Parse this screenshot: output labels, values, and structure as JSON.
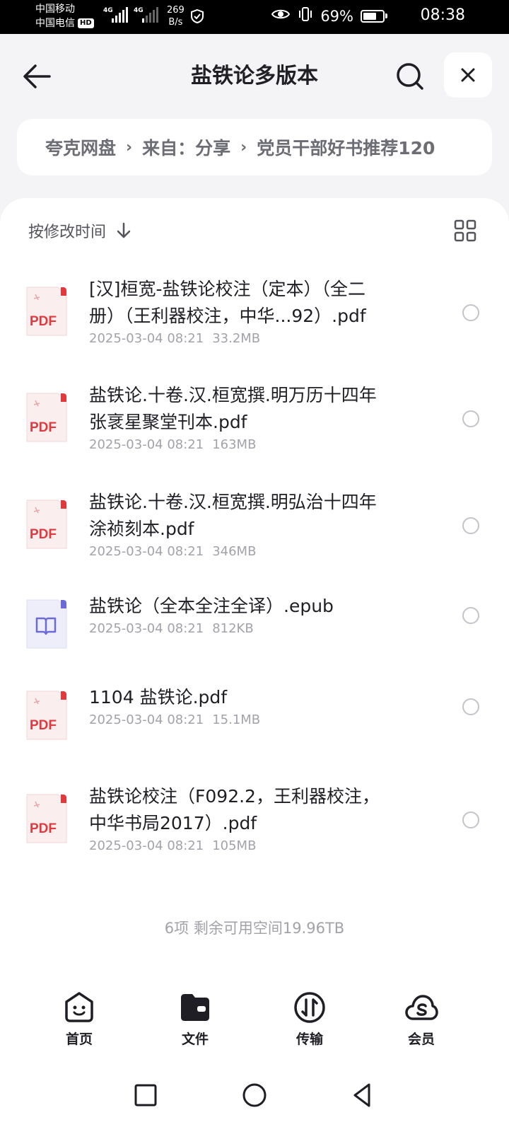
{
  "status_bar": {
    "carrier1": "中国移动",
    "carrier2": "中国电信",
    "hd": "HD",
    "net1": "4G",
    "net2": "4G",
    "speed_value": "269",
    "speed_unit": "B/s",
    "battery": "69%",
    "battery_level": 0.69,
    "time": "08:38"
  },
  "header": {
    "title": "盐铁论多版本",
    "back_icon": "back-arrow-icon",
    "search_icon": "search-icon",
    "close_icon": "close-icon"
  },
  "breadcrumb": {
    "items": [
      "夸克网盘",
      "来自：分享",
      "党员干部好书推荐120"
    ]
  },
  "sort": {
    "label": "按修改时间",
    "direction_icon": "arrow-down-icon",
    "view_icon": "grid-view-icon"
  },
  "files": [
    {
      "type": "pdf",
      "icon_label": "PDF",
      "name_line1": "[汉]桓宽-盐铁论校注（定本）（全二",
      "name_line2": "册）（王利器校注，中华...92）.pdf",
      "date": "2025-03-04 08:21",
      "size": "33.2MB"
    },
    {
      "type": "pdf",
      "icon_label": "PDF",
      "name_line1": "盐铁论.十卷.汉.桓宽撰.明万历十四年",
      "name_line2": "张衺星聚堂刊本.pdf",
      "date": "2025-03-04 08:21",
      "size": "163MB"
    },
    {
      "type": "pdf",
      "icon_label": "PDF",
      "name_line1": "盐铁论.十卷.汉.桓宽撰.明弘治十四年",
      "name_line2": "涂祯刻本.pdf",
      "date": "2025-03-04 08:21",
      "size": "346MB"
    },
    {
      "type": "epub",
      "icon_label": "",
      "name_line1": "盐铁论（全本全注全译）.epub",
      "name_line2": "",
      "date": "2025-03-04 08:21",
      "size": "812KB"
    },
    {
      "type": "pdf",
      "icon_label": "PDF",
      "name_line1": "1104 盐铁论.pdf",
      "name_line2": "",
      "date": "2025-03-04 08:21",
      "size": "15.1MB"
    },
    {
      "type": "pdf",
      "icon_label": "PDF",
      "name_line1": "盐铁论校注（F092.2，王利器校注，",
      "name_line2": "中华书局2017）.pdf",
      "date": "2025-03-04 08:21",
      "size": "105MB"
    }
  ],
  "summary": "6项 剩余可用空间19.96TB",
  "bottom_nav": [
    {
      "label": "首页",
      "icon": "home-smile-icon"
    },
    {
      "label": "文件",
      "icon": "folder-icon"
    },
    {
      "label": "传输",
      "icon": "transfer-icon"
    },
    {
      "label": "会员",
      "icon": "member-cloud-icon"
    }
  ],
  "colors": {
    "pdf_red": "#e0393e",
    "epub_purple": "#6b6bd8",
    "background": "#f4f4f6"
  }
}
